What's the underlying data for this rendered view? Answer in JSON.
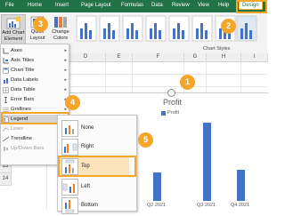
{
  "ribbon": {
    "tabs": [
      {
        "label": "File"
      },
      {
        "label": "Home"
      },
      {
        "label": "Insert"
      },
      {
        "label": "Page Layout"
      },
      {
        "label": "Formulas"
      },
      {
        "label": "Data"
      },
      {
        "label": "Review"
      },
      {
        "label": "View"
      },
      {
        "label": "Help"
      },
      {
        "label": "Design"
      }
    ],
    "buttons": {
      "add_chart_element": "Add Chart\nElement",
      "quick_layout": "Quick\nLayout",
      "change_colors": "Change\nColors"
    },
    "group_label": "Chart Styles"
  },
  "grid": {
    "columns": [
      "B",
      "C",
      "D",
      "E",
      "F",
      "G",
      "H",
      "I"
    ],
    "rows": [
      "5",
      "6",
      "7",
      "8",
      "9",
      "10",
      "11",
      "12",
      "13",
      "14"
    ]
  },
  "add_chart_element_menu": {
    "items": [
      {
        "label": "Axes",
        "icon": "axes-icon",
        "has_submenu": true,
        "enabled": true
      },
      {
        "label": "Axis Titles",
        "icon": "axis-titles-icon",
        "has_submenu": true,
        "enabled": true
      },
      {
        "label": "Chart Title",
        "icon": "chart-title-icon",
        "has_submenu": true,
        "enabled": true
      },
      {
        "label": "Data Labels",
        "icon": "data-labels-icon",
        "has_submenu": true,
        "enabled": true
      },
      {
        "label": "Data Table",
        "icon": "data-table-icon",
        "has_submenu": true,
        "enabled": true
      },
      {
        "label": "Error Bars",
        "icon": "error-bars-icon",
        "has_submenu": true,
        "enabled": true
      },
      {
        "label": "Gridlines",
        "icon": "gridlines-icon",
        "has_submenu": true,
        "enabled": true
      },
      {
        "label": "Legend",
        "icon": "legend-icon",
        "has_submenu": true,
        "enabled": true
      },
      {
        "label": "Lines",
        "icon": "lines-icon",
        "has_submenu": true,
        "enabled": false
      },
      {
        "label": "Trendline",
        "icon": "trendline-icon",
        "has_submenu": true,
        "enabled": true
      },
      {
        "label": "Up/Down Bars",
        "icon": "up-down-bars-icon",
        "has_submenu": true,
        "enabled": false
      }
    ]
  },
  "legend_submenu": {
    "items": [
      {
        "label": "None",
        "icon": "legend-none-icon"
      },
      {
        "label": "Right",
        "icon": "legend-right-icon"
      },
      {
        "label": "Top",
        "icon": "legend-top-icon"
      },
      {
        "label": "Left",
        "icon": "legend-left-icon"
      },
      {
        "label": "Bottom",
        "icon": "legend-bottom-icon"
      }
    ]
  },
  "callouts": [
    "1",
    "2",
    "3",
    "4",
    "5"
  ],
  "colors": {
    "excel_green": "#217346",
    "accent_orange": "#f4a52a",
    "bar_blue": "#4472c4"
  },
  "chart_data": {
    "type": "bar",
    "title": "Profit",
    "legend": "top",
    "series": [
      {
        "name": "Profit"
      }
    ],
    "categories": [
      "Q2 2021",
      "Q3 2021",
      "Q4 2021"
    ],
    "bar_fraction": [
      0.33,
      0.92,
      0.36
    ],
    "visible_tick_labels": [
      "Q2 2021",
      "Q3 2021",
      "Q4 2021"
    ]
  }
}
